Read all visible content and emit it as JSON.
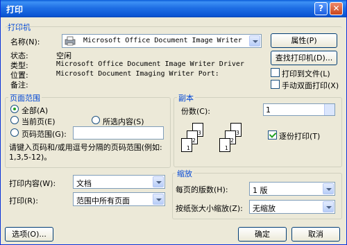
{
  "window": {
    "title": "打印",
    "help_btn": "?",
    "close_btn": "✕"
  },
  "printer": {
    "group_title": "打印机",
    "name_label": "名称(N):",
    "name_value": "Microsoft Office Document Image Writer",
    "properties_btn": "属性(P)",
    "find_btn": "查找打印机(D)...",
    "status_label": "状态:",
    "status_value": "空闲",
    "type_label": "类型:",
    "type_value": "Microsoft Office Document Image Writer Driver",
    "where_label": "位置:",
    "where_value": "Microsoft Document Imaging Writer Port:",
    "comment_label": "备注:",
    "print_to_file": "打印到文件(L)",
    "manual_duplex": "手动双面打印(X)"
  },
  "page_range": {
    "group_title": "页面范围",
    "all": "全部(A)",
    "current": "当前页(E)",
    "selection": "所选内容(S)",
    "pages": "页码范围(G):",
    "hint": "请键入页码和/或用逗号分隔的页码范围(例如: 1,3,5-12)。"
  },
  "copies": {
    "group_title": "副本",
    "count_label": "份数(C):",
    "count_value": "1",
    "collate": "逐份打印(T)",
    "page_nums": [
      "3",
      "2",
      "1",
      "3",
      "2",
      "1"
    ]
  },
  "print_what": {
    "label": "打印内容(W):",
    "value": "文档"
  },
  "print_range": {
    "label": "打印(R):",
    "value": "范围中所有页面"
  },
  "zoom": {
    "group_title": "缩放",
    "pages_per_sheet_label": "每页的版数(H):",
    "pages_per_sheet_value": "1 版",
    "scale_label": "按纸张大小缩放(Z):",
    "scale_value": "无缩放"
  },
  "footer": {
    "options_btn": "选项(O)...",
    "ok_btn": "确定",
    "cancel_btn": "取消"
  }
}
